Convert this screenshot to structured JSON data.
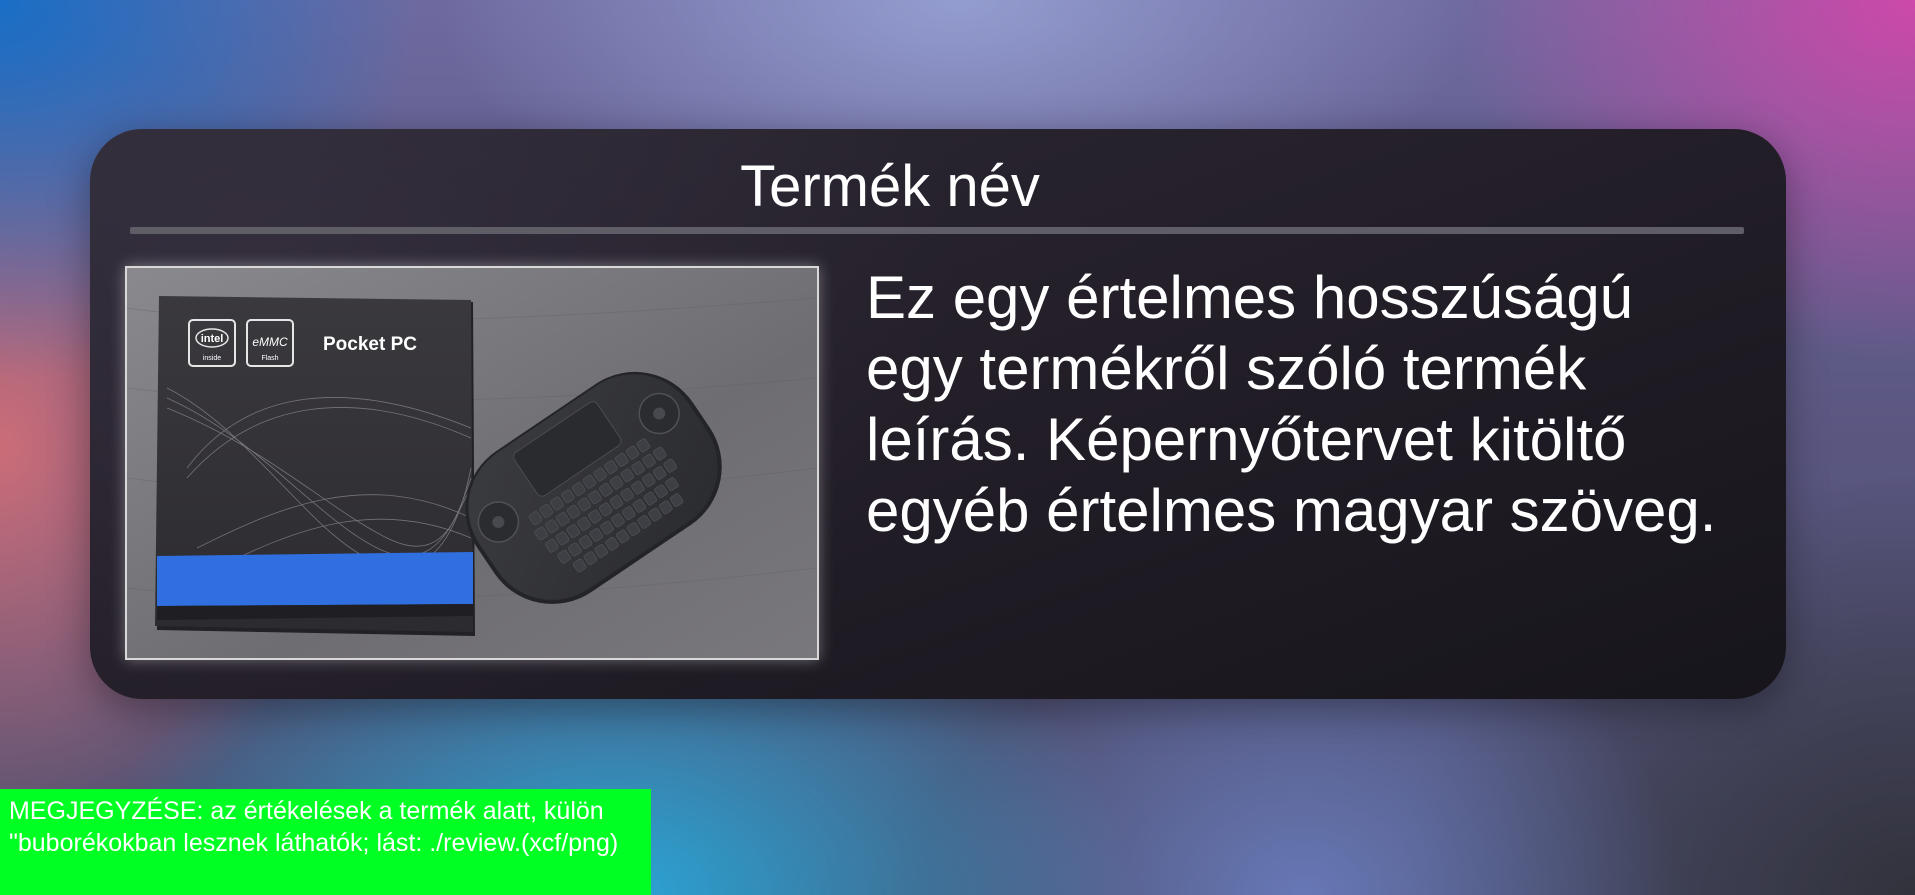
{
  "product": {
    "title": "Termék név",
    "description": "Ez egy értelmes hosszúságú egy termékről szóló termék leírás. Képernyőtervet kitöltő egyéb értelmes magyar szöveg.",
    "image": {
      "box_brand_labels": [
        "intel",
        "inside",
        "eMMC",
        "Flash"
      ],
      "box_title": "Pocket PC"
    }
  },
  "note": {
    "text": "MEGJEGYZÉSE: az értékelések a termék alatt, külön \"buborékokban lesznek láthatók; lást: ./review.(xcf/png)"
  },
  "colors": {
    "card_background": "#241f29",
    "divider": "#5f5d66",
    "note_background": "#00ff22",
    "text": "#ffffff",
    "box_stripe": "#2f6fe0"
  }
}
